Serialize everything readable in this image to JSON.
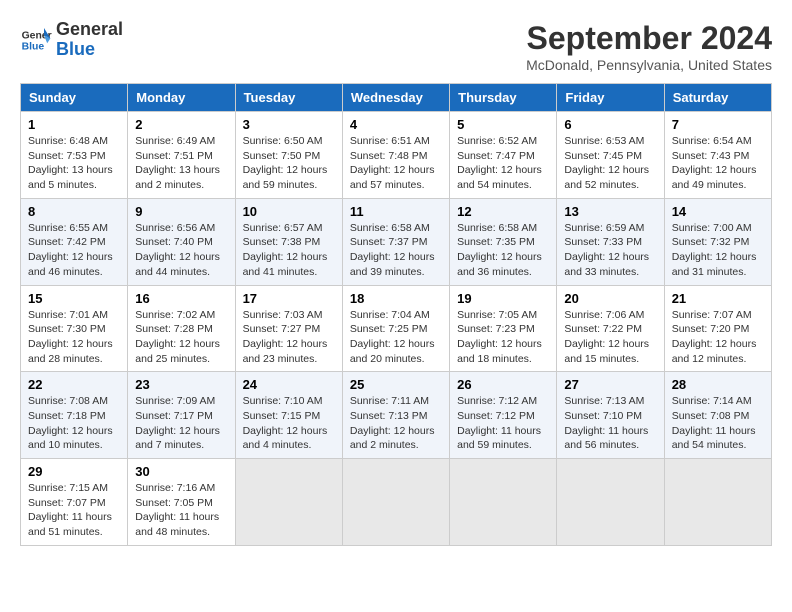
{
  "header": {
    "logo_line1": "General",
    "logo_line2": "Blue",
    "month_title": "September 2024",
    "location": "McDonald, Pennsylvania, United States"
  },
  "weekdays": [
    "Sunday",
    "Monday",
    "Tuesday",
    "Wednesday",
    "Thursday",
    "Friday",
    "Saturday"
  ],
  "weeks": [
    [
      {
        "day": "1",
        "info": "Sunrise: 6:48 AM\nSunset: 7:53 PM\nDaylight: 13 hours\nand 5 minutes."
      },
      {
        "day": "2",
        "info": "Sunrise: 6:49 AM\nSunset: 7:51 PM\nDaylight: 13 hours\nand 2 minutes."
      },
      {
        "day": "3",
        "info": "Sunrise: 6:50 AM\nSunset: 7:50 PM\nDaylight: 12 hours\nand 59 minutes."
      },
      {
        "day": "4",
        "info": "Sunrise: 6:51 AM\nSunset: 7:48 PM\nDaylight: 12 hours\nand 57 minutes."
      },
      {
        "day": "5",
        "info": "Sunrise: 6:52 AM\nSunset: 7:47 PM\nDaylight: 12 hours\nand 54 minutes."
      },
      {
        "day": "6",
        "info": "Sunrise: 6:53 AM\nSunset: 7:45 PM\nDaylight: 12 hours\nand 52 minutes."
      },
      {
        "day": "7",
        "info": "Sunrise: 6:54 AM\nSunset: 7:43 PM\nDaylight: 12 hours\nand 49 minutes."
      }
    ],
    [
      {
        "day": "8",
        "info": "Sunrise: 6:55 AM\nSunset: 7:42 PM\nDaylight: 12 hours\nand 46 minutes."
      },
      {
        "day": "9",
        "info": "Sunrise: 6:56 AM\nSunset: 7:40 PM\nDaylight: 12 hours\nand 44 minutes."
      },
      {
        "day": "10",
        "info": "Sunrise: 6:57 AM\nSunset: 7:38 PM\nDaylight: 12 hours\nand 41 minutes."
      },
      {
        "day": "11",
        "info": "Sunrise: 6:58 AM\nSunset: 7:37 PM\nDaylight: 12 hours\nand 39 minutes."
      },
      {
        "day": "12",
        "info": "Sunrise: 6:58 AM\nSunset: 7:35 PM\nDaylight: 12 hours\nand 36 minutes."
      },
      {
        "day": "13",
        "info": "Sunrise: 6:59 AM\nSunset: 7:33 PM\nDaylight: 12 hours\nand 33 minutes."
      },
      {
        "day": "14",
        "info": "Sunrise: 7:00 AM\nSunset: 7:32 PM\nDaylight: 12 hours\nand 31 minutes."
      }
    ],
    [
      {
        "day": "15",
        "info": "Sunrise: 7:01 AM\nSunset: 7:30 PM\nDaylight: 12 hours\nand 28 minutes."
      },
      {
        "day": "16",
        "info": "Sunrise: 7:02 AM\nSunset: 7:28 PM\nDaylight: 12 hours\nand 25 minutes."
      },
      {
        "day": "17",
        "info": "Sunrise: 7:03 AM\nSunset: 7:27 PM\nDaylight: 12 hours\nand 23 minutes."
      },
      {
        "day": "18",
        "info": "Sunrise: 7:04 AM\nSunset: 7:25 PM\nDaylight: 12 hours\nand 20 minutes."
      },
      {
        "day": "19",
        "info": "Sunrise: 7:05 AM\nSunset: 7:23 PM\nDaylight: 12 hours\nand 18 minutes."
      },
      {
        "day": "20",
        "info": "Sunrise: 7:06 AM\nSunset: 7:22 PM\nDaylight: 12 hours\nand 15 minutes."
      },
      {
        "day": "21",
        "info": "Sunrise: 7:07 AM\nSunset: 7:20 PM\nDaylight: 12 hours\nand 12 minutes."
      }
    ],
    [
      {
        "day": "22",
        "info": "Sunrise: 7:08 AM\nSunset: 7:18 PM\nDaylight: 12 hours\nand 10 minutes."
      },
      {
        "day": "23",
        "info": "Sunrise: 7:09 AM\nSunset: 7:17 PM\nDaylight: 12 hours\nand 7 minutes."
      },
      {
        "day": "24",
        "info": "Sunrise: 7:10 AM\nSunset: 7:15 PM\nDaylight: 12 hours\nand 4 minutes."
      },
      {
        "day": "25",
        "info": "Sunrise: 7:11 AM\nSunset: 7:13 PM\nDaylight: 12 hours\nand 2 minutes."
      },
      {
        "day": "26",
        "info": "Sunrise: 7:12 AM\nSunset: 7:12 PM\nDaylight: 11 hours\nand 59 minutes."
      },
      {
        "day": "27",
        "info": "Sunrise: 7:13 AM\nSunset: 7:10 PM\nDaylight: 11 hours\nand 56 minutes."
      },
      {
        "day": "28",
        "info": "Sunrise: 7:14 AM\nSunset: 7:08 PM\nDaylight: 11 hours\nand 54 minutes."
      }
    ],
    [
      {
        "day": "29",
        "info": "Sunrise: 7:15 AM\nSunset: 7:07 PM\nDaylight: 11 hours\nand 51 minutes."
      },
      {
        "day": "30",
        "info": "Sunrise: 7:16 AM\nSunset: 7:05 PM\nDaylight: 11 hours\nand 48 minutes."
      },
      {
        "day": "",
        "info": ""
      },
      {
        "day": "",
        "info": ""
      },
      {
        "day": "",
        "info": ""
      },
      {
        "day": "",
        "info": ""
      },
      {
        "day": "",
        "info": ""
      }
    ]
  ]
}
